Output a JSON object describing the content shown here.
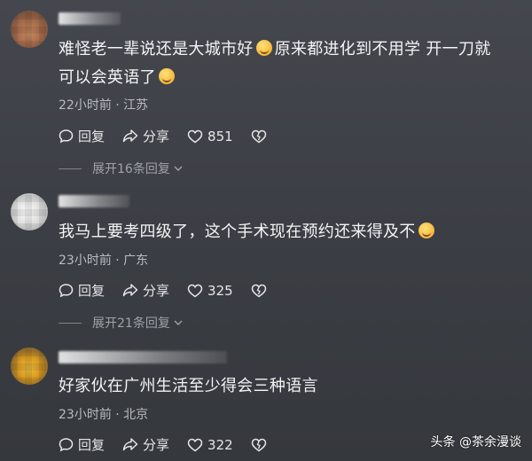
{
  "comments": [
    {
      "text_a": "难怪老一辈说还是大城市好",
      "text_b": "原来都进化到不用学 开一刀就",
      "text_c": "可以会英语了",
      "meta": "22小时前 · 江苏",
      "reply_label": "回复",
      "share_label": "分享",
      "likes": "851",
      "expand_label": "展开16条回复"
    },
    {
      "text_a": "我马上要考四级了，这个手术现在预约还来得及不",
      "meta": "23小时前 · 广东",
      "reply_label": "回复",
      "share_label": "分享",
      "likes": "325",
      "expand_label": "展开21条回复"
    },
    {
      "text_a": "好家伙在广州生活至少得会三种语言",
      "meta": "23小时前 · 北京",
      "reply_label": "回复",
      "share_label": "分享",
      "likes": "322"
    }
  ],
  "watermark": "头条 @茶余漫谈",
  "icons": [
    "reply-icon",
    "share-icon",
    "heart-icon",
    "dislike-icon",
    "chevron-down-icon",
    "emoji-icon"
  ]
}
